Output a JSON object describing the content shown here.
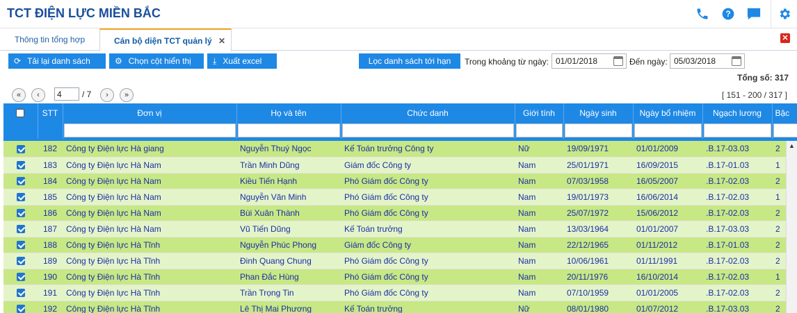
{
  "header": {
    "title": "TCT ĐIỆN LỰC MIỀN BẮC",
    "icons": [
      "phone-icon",
      "help-icon",
      "chat-icon",
      "gear-icon"
    ]
  },
  "tabs": [
    {
      "label": "Thông tin tổng hợp",
      "active": false
    },
    {
      "label": "Cán bộ diện TCT quản lý",
      "active": true
    }
  ],
  "toolbar": {
    "reload_label": "Tải lại danh sách",
    "columns_label": "Chọn cột hiển thị",
    "export_label": "Xuất excel",
    "filter_label": "Lọc danh sách tới hạn",
    "from_label": "Trong khoảng từ ngày:",
    "from_value": "01/01/2018",
    "to_label": "Đến ngày:",
    "to_value": "05/03/2018"
  },
  "summary": {
    "total_label": "Tổng số: 317"
  },
  "pager": {
    "page": "4",
    "total_pages": "/ 7",
    "range": "[ 151 - 200 / 317 ]"
  },
  "columns": [
    "STT",
    "Đơn vị",
    "Họ và tên",
    "Chức danh",
    "Giới tính",
    "Ngày sinh",
    "Ngày bổ nhiệm",
    "Ngạch lương",
    "Bậc"
  ],
  "rows": [
    {
      "stt": "182",
      "don_vi": "Công ty Điện lực Hà giang",
      "ho_ten": "Nguyễn Thuý Ngọc",
      "chuc_danh": "Kế Toán trưởng Công ty",
      "gioi_tinh": "Nữ",
      "ngay_sinh": "19/09/1971",
      "ngay_bn": "01/01/2009",
      "ngach": ".B.17-03.03",
      "bac": "2"
    },
    {
      "stt": "183",
      "don_vi": "Công ty Điện lực Hà Nam",
      "ho_ten": "Trần Minh Dũng",
      "chuc_danh": "Giám đốc Công ty",
      "gioi_tinh": "Nam",
      "ngay_sinh": "25/01/1971",
      "ngay_bn": "16/09/2015",
      "ngach": ".B.17-01.03",
      "bac": "1"
    },
    {
      "stt": "184",
      "don_vi": "Công ty Điện lực Hà Nam",
      "ho_ten": "Kiều Tiến Hạnh",
      "chuc_danh": "Phó Giám đốc Công ty",
      "gioi_tinh": "Nam",
      "ngay_sinh": "07/03/1958",
      "ngay_bn": "16/05/2007",
      "ngach": ".B.17-02.03",
      "bac": "2"
    },
    {
      "stt": "185",
      "don_vi": "Công ty Điện lực Hà Nam",
      "ho_ten": "Nguyễn Văn Minh",
      "chuc_danh": "Phó Giám đốc Công ty",
      "gioi_tinh": "Nam",
      "ngay_sinh": "19/01/1973",
      "ngay_bn": "16/06/2014",
      "ngach": ".B.17-02.03",
      "bac": "1"
    },
    {
      "stt": "186",
      "don_vi": "Công ty Điện lực Hà Nam",
      "ho_ten": "Bùi Xuân Thành",
      "chuc_danh": "Phó Giám đốc Công ty",
      "gioi_tinh": "Nam",
      "ngay_sinh": "25/07/1972",
      "ngay_bn": "15/06/2012",
      "ngach": ".B.17-02.03",
      "bac": "2"
    },
    {
      "stt": "187",
      "don_vi": "Công ty Điện lực Hà Nam",
      "ho_ten": "Vũ Tiến Dũng",
      "chuc_danh": "Kế Toán trưởng",
      "gioi_tinh": "Nam",
      "ngay_sinh": "13/03/1964",
      "ngay_bn": "01/01/2007",
      "ngach": ".B.17-03.03",
      "bac": "2"
    },
    {
      "stt": "188",
      "don_vi": "Công ty Điện lực Hà Tĩnh",
      "ho_ten": "Nguyễn Phúc Phong",
      "chuc_danh": "Giám đốc Công ty",
      "gioi_tinh": "Nam",
      "ngay_sinh": "22/12/1965",
      "ngay_bn": "01/11/2012",
      "ngach": ".B.17-01.03",
      "bac": "2"
    },
    {
      "stt": "189",
      "don_vi": "Công ty Điện lực Hà Tĩnh",
      "ho_ten": "Đinh Quang Chung",
      "chuc_danh": "Phó Giám đốc Công ty",
      "gioi_tinh": "Nam",
      "ngay_sinh": "10/06/1961",
      "ngay_bn": "01/11/1991",
      "ngach": ".B.17-02.03",
      "bac": "2"
    },
    {
      "stt": "190",
      "don_vi": "Công ty Điện lực Hà Tĩnh",
      "ho_ten": "Phan Đắc Hùng",
      "chuc_danh": "Phó Giám đốc Công ty",
      "gioi_tinh": "Nam",
      "ngay_sinh": "20/11/1976",
      "ngay_bn": "16/10/2014",
      "ngach": ".B.17-02.03",
      "bac": "1"
    },
    {
      "stt": "191",
      "don_vi": "Công ty Điện lực Hà Tĩnh",
      "ho_ten": "Trần Trọng Tin",
      "chuc_danh": "Phó Giám đốc Công ty",
      "gioi_tinh": "Nam",
      "ngay_sinh": "07/10/1959",
      "ngay_bn": "01/01/2005",
      "ngach": ".B.17-02.03",
      "bac": "2"
    },
    {
      "stt": "192",
      "don_vi": "Công ty Điện lực Hà Tĩnh",
      "ho_ten": "Lê Thị Mai Phương",
      "chuc_danh": "Kế Toán trưởng",
      "gioi_tinh": "Nữ",
      "ngay_sinh": "08/01/1980",
      "ngay_bn": "01/07/2012",
      "ngach": ".B.17-03.03",
      "bac": "2"
    }
  ]
}
